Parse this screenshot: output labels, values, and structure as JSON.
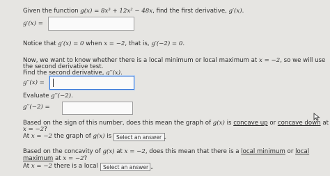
{
  "intro": {
    "prefix": "Given the function ",
    "function": "g(x) = 8x³ + 12x² − 48x",
    "suffix": ", find the first derivative, ",
    "target": "g′(x)",
    "end": "."
  },
  "first_derivative": {
    "label": "g′(x) =",
    "value": ""
  },
  "notice": {
    "text1": "Notice that ",
    "eq1": "g′(x) = 0",
    "text2": " when ",
    "eq2": "x = −2",
    "text3": ", that is, ",
    "eq3": "g′(−2) = 0",
    "end": "."
  },
  "local_q": {
    "line1_a": "Now, we want to know whether there is a local minimum or local maximum at ",
    "line1_eq": "x = −2",
    "line1_b": ", so we will use",
    "line2": "the second derivative test.",
    "line3_a": "Find the second derivative, ",
    "line3_eq": "g′′(x)",
    "line3_b": "."
  },
  "second_derivative": {
    "label": "g′′(x) =",
    "value": ""
  },
  "evaluate": {
    "text": "Evaluate ",
    "eq": "g′′(−2)",
    "end": ".",
    "label": "g′′(−2) =",
    "value": ""
  },
  "concavity_q": {
    "line1_a": "Based on the sign of this number, does this mean the graph of ",
    "line1_eq": "g(x)",
    "line1_b": " is ",
    "concave_up": "concave up",
    "or": " or ",
    "concave_down": "concave down",
    "at": " at",
    "line2_eq": "x = −2",
    "line2_b": "?",
    "line3_a": "At ",
    "line3_eq": "x = −2",
    "line3_b": " the graph of ",
    "line3_eq2": "g(x)",
    "line3_c": " is",
    "select": "Select an answer"
  },
  "extremum_q": {
    "line1_a": "Based on the concavity of ",
    "line1_eq": "g(x)",
    "line1_b": " at ",
    "line1_eq2": "x = −2",
    "line1_c": ", does this mean that there is a ",
    "local_minimum": "local minimum",
    "or": " or ",
    "local": "local",
    "line2_maximum": "maximum",
    "line2_b": " at ",
    "line2_eq": "x = −2",
    "line2_c": "?",
    "line3_a": "At ",
    "line3_eq": "x = −2",
    "line3_b": " there is a local",
    "select": "Select an answer"
  },
  "icons": {
    "cursor": "mouse-pointer-icon",
    "dropdown": "chevron-down-icon"
  }
}
